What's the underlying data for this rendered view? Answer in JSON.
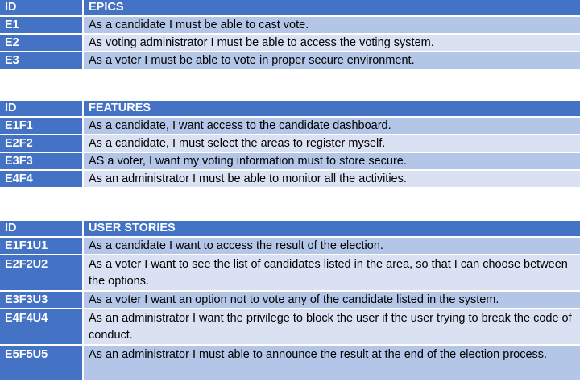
{
  "epics": {
    "id_header": "ID",
    "title_header": "EPICS",
    "rows": [
      {
        "id": "E1",
        "text": "As a candidate I must be able to cast vote."
      },
      {
        "id": "E2",
        "text": "As voting administrator I must be able to access the voting system."
      },
      {
        "id": "E3",
        "text": "As a voter I must be able to vote in proper secure environment."
      }
    ]
  },
  "features": {
    "id_header": "ID",
    "title_header": "FEATURES",
    "rows": [
      {
        "id": "E1F1",
        "text": "As a candidate, I want access to the candidate dashboard."
      },
      {
        "id": "E2F2",
        "text": "As a candidate, I must select the areas to register myself."
      },
      {
        "id": "E3F3",
        "text": "AS a voter, I want my voting information must to store secure."
      },
      {
        "id": "E4F4",
        "text": "As an administrator I must be able to monitor all the activities."
      }
    ]
  },
  "user_stories": {
    "id_header": "ID",
    "title_header": "USER STORIES",
    "rows": [
      {
        "id": "E1F1U1",
        "text": "As a candidate I want to access the result of the election."
      },
      {
        "id": "E2F2U2",
        "text": "As a voter I want to see the list of candidates listed in the area, so that I can choose between the options."
      },
      {
        "id": "E3F3U3",
        "text": "As a voter I want an option not to vote any of the candidate listed in the system."
      },
      {
        "id": "E4F4U4",
        "text": "As an administrator I want the privilege to block the user if the user trying to break the code of conduct."
      },
      {
        "id": "E5F5U5",
        "text": "As an administrator I must able to announce the result at the end of the election process."
      }
    ]
  }
}
